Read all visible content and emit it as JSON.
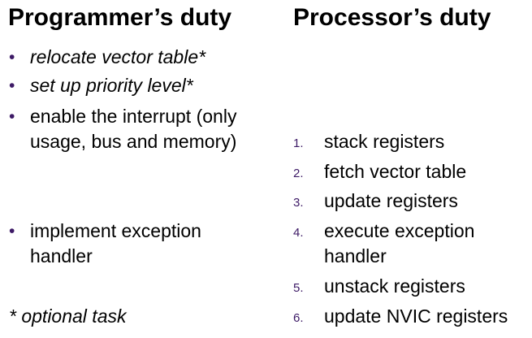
{
  "headings": {
    "programmer": "Programmer’s duty",
    "processor": "Processor’s duty"
  },
  "bullet_symbol": "•",
  "programmer_items": [
    {
      "text": "relocate vector table*",
      "italic": true
    },
    {
      "text": "set up priority level*",
      "italic": true
    },
    {
      "text": "enable the interrupt (only usage, bus and memory)",
      "italic": false
    },
    {
      "text": "implement exception handler",
      "italic": false
    }
  ],
  "processor_steps": [
    {
      "num": "1.",
      "text": "stack registers"
    },
    {
      "num": "2.",
      "text": "fetch vector table"
    },
    {
      "num": "3.",
      "text": "update registers"
    },
    {
      "num": "4.",
      "text": "execute exception handler"
    },
    {
      "num": "5.",
      "text": "unstack registers"
    },
    {
      "num": "6.",
      "text": "update NVIC registers"
    }
  ],
  "footnote": "* optional task",
  "colors": {
    "text": "#000000",
    "bullet": "#3d1a66",
    "background": "#ffffff"
  }
}
